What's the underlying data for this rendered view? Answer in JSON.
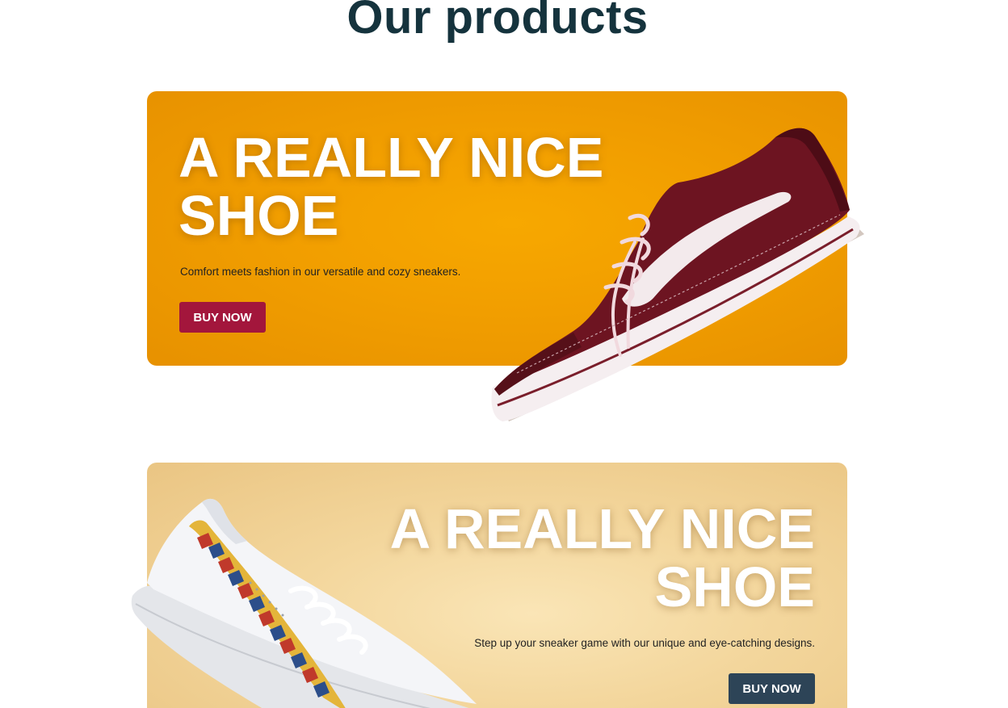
{
  "section": {
    "title": "Our products"
  },
  "products": [
    {
      "title_line1": "A REALLY NICE",
      "title_line2": "SHOE",
      "description": "Comfort meets fashion in our versatile and cozy sneakers.",
      "button_label": "BUY NOW",
      "background_color": "#f2a000",
      "button_color": "#a3163c",
      "image": "maroon-canvas-sneaker"
    },
    {
      "title_line1": "A REALLY NICE",
      "title_line2": "SHOE",
      "description": "Step up your sneaker game with our unique and eye-catching designs.",
      "button_label": "BUY NOW",
      "background_color": "#f3d69c",
      "button_color": "#2d4457",
      "image": "white-leather-sneaker-with-patterned-stripe"
    }
  ],
  "colors": {
    "heading": "#15333d",
    "card_title": "#ffffff"
  }
}
